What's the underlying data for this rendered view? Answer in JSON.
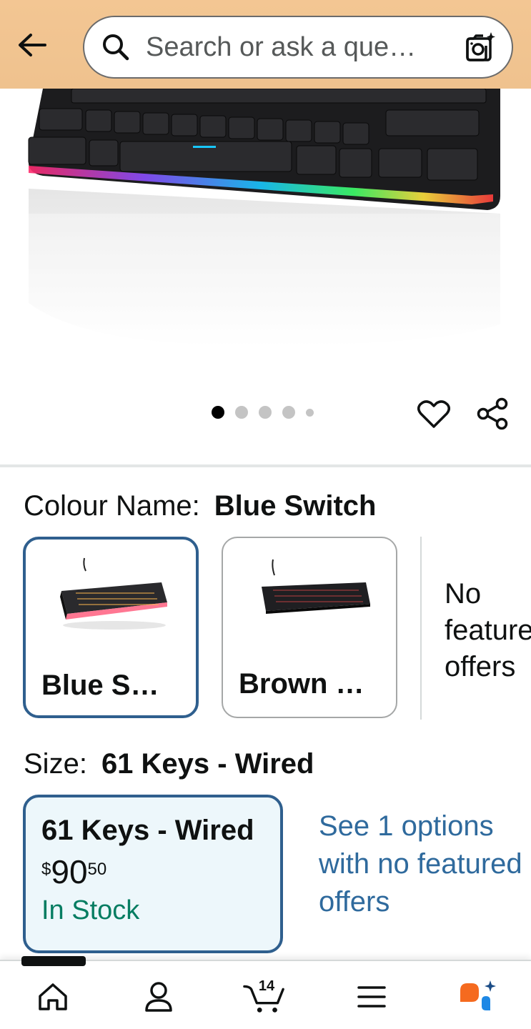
{
  "header": {
    "search_placeholder": "Search or ask a que…",
    "back_icon": "arrow-left-icon",
    "search_icon": "search-icon",
    "camera_icon": "camera-sparkle-icon"
  },
  "gallery": {
    "image_count": 5,
    "active_index": 0
  },
  "colour": {
    "label": "Colour Name:",
    "selected": "Blue Switch",
    "options": [
      {
        "title": "Blue S…"
      },
      {
        "title": "Brown …"
      }
    ],
    "no_featured": [
      "No",
      "featured",
      "offers"
    ]
  },
  "size": {
    "label": "Size:",
    "selected": "61 Keys - Wired",
    "card": {
      "title": "61 Keys - Wired",
      "price_symbol": "$",
      "price_whole": "90",
      "price_fraction": "50",
      "stock": "In Stock"
    },
    "see_options": "See 1 options with no featured offers"
  },
  "nav": {
    "cart_count": "14",
    "items": [
      "home-icon",
      "account-icon",
      "cart-icon",
      "menu-icon",
      "rufus-icon"
    ]
  },
  "colors": {
    "header_bg": "#f3c693",
    "selected_border": "#2f5f8e",
    "link": "#2f6a9d",
    "in_stock": "#067d62",
    "size_card_bg": "#edf7fb"
  }
}
